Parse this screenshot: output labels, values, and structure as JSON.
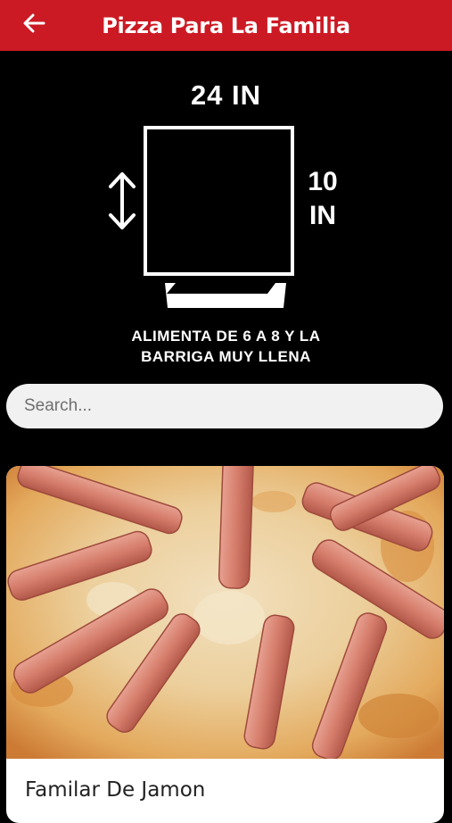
{
  "header": {
    "title": "Pizza Para La Familia",
    "back_icon": "arrow-left-icon",
    "color": "#cc1a24"
  },
  "size_info": {
    "width_label": "24 IN",
    "height_label": "10 IN",
    "description_line1": "ALIMENTA DE 6 A 8 Y LA",
    "description_line2": "BARRIGA MUY LLENA"
  },
  "search": {
    "placeholder": "Search...",
    "value": ""
  },
  "products": [
    {
      "name": "Familar De Jamon",
      "image": "ham-pizza-photo"
    }
  ]
}
